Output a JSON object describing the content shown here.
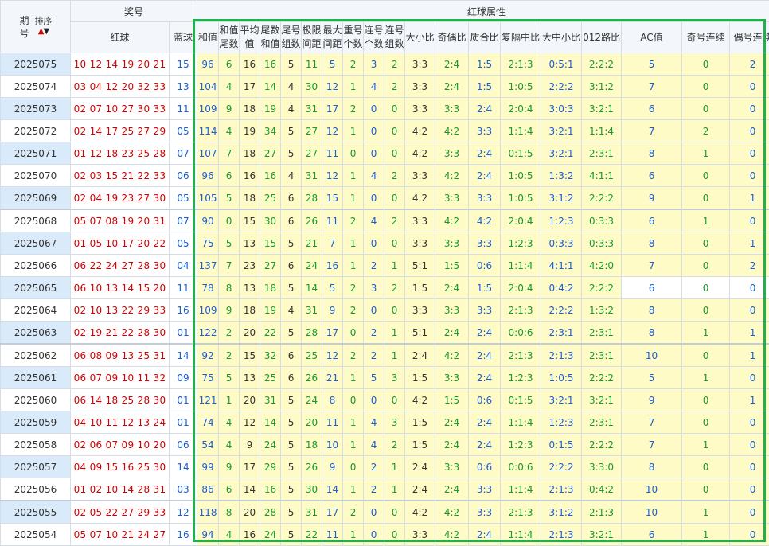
{
  "header": {
    "period": "期号",
    "sort_label": "排序",
    "prize_group": "奖号",
    "red_ball": "红球",
    "blue_ball": "蓝球",
    "attr_group": "红球属性",
    "cols": [
      "和值",
      "和值尾数",
      "平均值",
      "尾数和值",
      "尾号组数",
      "极限间距",
      "最大间距",
      "重号个数",
      "连号个数",
      "连号组数",
      "大小比",
      "奇偶比",
      "质合比",
      "复隔中比",
      "大中小比",
      "012路比",
      "AC值",
      "奇号连续",
      "偶号连续"
    ]
  },
  "rows": [
    {
      "period": "2025075",
      "red": "10 12 14 19 20 21",
      "blue": "15",
      "attrs": [
        "96",
        "6",
        "16",
        "16",
        "5",
        "11",
        "5",
        "2",
        "3",
        "2",
        "3:3",
        "2:4",
        "1:5",
        "2:1:3",
        "0:5:1",
        "2:2:2",
        "5",
        "0",
        "2"
      ]
    },
    {
      "period": "2025074",
      "red": "03 04 12 20 32 33",
      "blue": "13",
      "attrs": [
        "104",
        "4",
        "17",
        "14",
        "4",
        "30",
        "12",
        "1",
        "4",
        "2",
        "3:3",
        "2:4",
        "1:5",
        "1:0:5",
        "2:2:2",
        "3:1:2",
        "7",
        "0",
        "0"
      ]
    },
    {
      "period": "2025073",
      "red": "02 07 10 27 30 33",
      "blue": "11",
      "attrs": [
        "109",
        "9",
        "18",
        "19",
        "4",
        "31",
        "17",
        "2",
        "0",
        "0",
        "3:3",
        "3:3",
        "2:4",
        "2:0:4",
        "3:0:3",
        "3:2:1",
        "6",
        "0",
        "0"
      ]
    },
    {
      "period": "2025072",
      "red": "02 14 17 25 27 29",
      "blue": "05",
      "attrs": [
        "114",
        "4",
        "19",
        "34",
        "5",
        "27",
        "12",
        "1",
        "0",
        "0",
        "4:2",
        "4:2",
        "3:3",
        "1:1:4",
        "3:2:1",
        "1:1:4",
        "7",
        "2",
        "0"
      ]
    },
    {
      "period": "2025071",
      "red": "01 12 18 23 25 28",
      "blue": "07",
      "attrs": [
        "107",
        "7",
        "18",
        "27",
        "5",
        "27",
        "11",
        "0",
        "0",
        "0",
        "4:2",
        "3:3",
        "2:4",
        "0:1:5",
        "3:2:1",
        "2:3:1",
        "8",
        "1",
        "0"
      ]
    },
    {
      "period": "2025070",
      "red": "02 03 15 21 22 33",
      "blue": "06",
      "attrs": [
        "96",
        "6",
        "16",
        "16",
        "4",
        "31",
        "12",
        "1",
        "4",
        "2",
        "3:3",
        "4:2",
        "2:4",
        "1:0:5",
        "1:3:2",
        "4:1:1",
        "6",
        "0",
        "0"
      ]
    },
    {
      "period": "2025069",
      "red": "02 04 19 23 27 30",
      "blue": "05",
      "attrs": [
        "105",
        "5",
        "18",
        "25",
        "6",
        "28",
        "15",
        "1",
        "0",
        "0",
        "4:2",
        "3:3",
        "3:3",
        "1:0:5",
        "3:1:2",
        "2:2:2",
        "9",
        "0",
        "1"
      ]
    },
    {
      "period": "2025068",
      "red": "05 07 08 19 20 31",
      "blue": "07",
      "attrs": [
        "90",
        "0",
        "15",
        "30",
        "6",
        "26",
        "11",
        "2",
        "4",
        "2",
        "3:3",
        "4:2",
        "4:2",
        "2:0:4",
        "1:2:3",
        "0:3:3",
        "6",
        "1",
        "0"
      ]
    },
    {
      "period": "2025067",
      "red": "01 05 10 17 20 22",
      "blue": "05",
      "attrs": [
        "75",
        "5",
        "13",
        "15",
        "5",
        "21",
        "7",
        "1",
        "0",
        "0",
        "3:3",
        "3:3",
        "3:3",
        "1:2:3",
        "0:3:3",
        "0:3:3",
        "8",
        "0",
        "1"
      ]
    },
    {
      "period": "2025066",
      "red": "06 22 24 27 28 30",
      "blue": "04",
      "attrs": [
        "137",
        "7",
        "23",
        "27",
        "6",
        "24",
        "16",
        "1",
        "2",
        "1",
        "5:1",
        "1:5",
        "0:6",
        "1:1:4",
        "4:1:1",
        "4:2:0",
        "7",
        "0",
        "2"
      ]
    },
    {
      "period": "2025065",
      "red": "06 10 13 14 15 20",
      "blue": "11",
      "attrs": [
        "78",
        "8",
        "13",
        "18",
        "5",
        "14",
        "5",
        "2",
        "3",
        "2",
        "1:5",
        "2:4",
        "1:5",
        "2:0:4",
        "0:4:2",
        "2:2:2",
        "6",
        "0",
        "0"
      ]
    },
    {
      "period": "2025064",
      "red": "02 10 13 22 29 33",
      "blue": "16",
      "attrs": [
        "109",
        "9",
        "18",
        "19",
        "4",
        "31",
        "9",
        "2",
        "0",
        "0",
        "3:3",
        "3:3",
        "3:3",
        "2:1:3",
        "2:2:2",
        "1:3:2",
        "8",
        "0",
        "0"
      ]
    },
    {
      "period": "2025063",
      "red": "02 19 21 22 28 30",
      "blue": "01",
      "attrs": [
        "122",
        "2",
        "20",
        "22",
        "5",
        "28",
        "17",
        "0",
        "2",
        "1",
        "5:1",
        "2:4",
        "2:4",
        "0:0:6",
        "2:3:1",
        "2:3:1",
        "8",
        "1",
        "1"
      ]
    },
    {
      "period": "2025062",
      "red": "06 08 09 13 25 31",
      "blue": "14",
      "attrs": [
        "92",
        "2",
        "15",
        "32",
        "6",
        "25",
        "12",
        "2",
        "2",
        "1",
        "2:4",
        "4:2",
        "2:4",
        "2:1:3",
        "2:1:3",
        "2:3:1",
        "10",
        "0",
        "1"
      ]
    },
    {
      "period": "2025061",
      "red": "06 07 09 10 11 32",
      "blue": "09",
      "attrs": [
        "75",
        "5",
        "13",
        "25",
        "6",
        "26",
        "21",
        "1",
        "5",
        "3",
        "1:5",
        "3:3",
        "2:4",
        "1:2:3",
        "1:0:5",
        "2:2:2",
        "5",
        "1",
        "0"
      ]
    },
    {
      "period": "2025060",
      "red": "06 14 18 25 28 30",
      "blue": "01",
      "attrs": [
        "121",
        "1",
        "20",
        "31",
        "5",
        "24",
        "8",
        "0",
        "0",
        "0",
        "4:2",
        "1:5",
        "0:6",
        "0:1:5",
        "3:2:1",
        "3:2:1",
        "9",
        "0",
        "1"
      ]
    },
    {
      "period": "2025059",
      "red": "04 10 11 12 13 24",
      "blue": "01",
      "attrs": [
        "74",
        "4",
        "12",
        "14",
        "5",
        "20",
        "11",
        "1",
        "4",
        "3",
        "1:5",
        "2:4",
        "2:4",
        "1:1:4",
        "1:2:3",
        "2:3:1",
        "7",
        "0",
        "0"
      ]
    },
    {
      "period": "2025058",
      "red": "02 06 07 09 10 20",
      "blue": "06",
      "attrs": [
        "54",
        "4",
        "9",
        "24",
        "5",
        "18",
        "10",
        "1",
        "4",
        "2",
        "1:5",
        "2:4",
        "2:4",
        "1:2:3",
        "0:1:5",
        "2:2:2",
        "7",
        "1",
        "0"
      ]
    },
    {
      "period": "2025057",
      "red": "04 09 15 16 25 30",
      "blue": "14",
      "attrs": [
        "99",
        "9",
        "17",
        "29",
        "5",
        "26",
        "9",
        "0",
        "2",
        "1",
        "2:4",
        "3:3",
        "0:6",
        "0:0:6",
        "2:2:2",
        "3:3:0",
        "8",
        "0",
        "0"
      ]
    },
    {
      "period": "2025056",
      "red": "01 02 10 14 28 31",
      "blue": "03",
      "attrs": [
        "86",
        "6",
        "14",
        "16",
        "5",
        "30",
        "14",
        "1",
        "2",
        "1",
        "2:4",
        "2:4",
        "3:3",
        "1:1:4",
        "2:1:3",
        "0:4:2",
        "10",
        "0",
        "0"
      ]
    },
    {
      "period": "2025055",
      "red": "02 05 22 27 29 33",
      "blue": "12",
      "attrs": [
        "118",
        "8",
        "20",
        "28",
        "5",
        "31",
        "17",
        "2",
        "0",
        "0",
        "4:2",
        "4:2",
        "3:3",
        "2:1:3",
        "3:1:2",
        "2:1:3",
        "10",
        "1",
        "0"
      ]
    },
    {
      "period": "2025054",
      "red": "05 07 10 21 24 27",
      "blue": "16",
      "attrs": [
        "94",
        "4",
        "16",
        "24",
        "5",
        "22",
        "11",
        "1",
        "0",
        "0",
        "3:3",
        "4:2",
        "2:4",
        "1:1:4",
        "2:1:3",
        "3:2:1",
        "6",
        "1",
        "0"
      ]
    }
  ]
}
